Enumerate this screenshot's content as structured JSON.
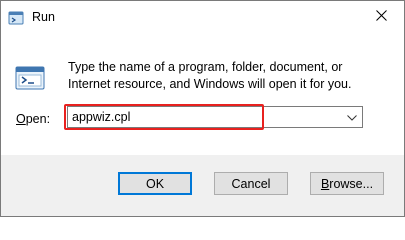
{
  "window": {
    "title": "Run"
  },
  "dialog": {
    "description": "Type the name of a program, folder, document, or Internet resource, and Windows will open it for you.",
    "open_label_accel": "O",
    "open_label_rest": "pen:",
    "open_value": "appwiz.cpl"
  },
  "buttons": {
    "ok_label": "OK",
    "cancel_label": "Cancel",
    "browse_accel": "B",
    "browse_rest": "rowse..."
  },
  "icons": {
    "app": "run-icon",
    "close": "close-icon",
    "dropdown": "chevron-down-icon"
  },
  "colors": {
    "highlight": "#e8211f",
    "default_button_border": "#0078d7"
  }
}
